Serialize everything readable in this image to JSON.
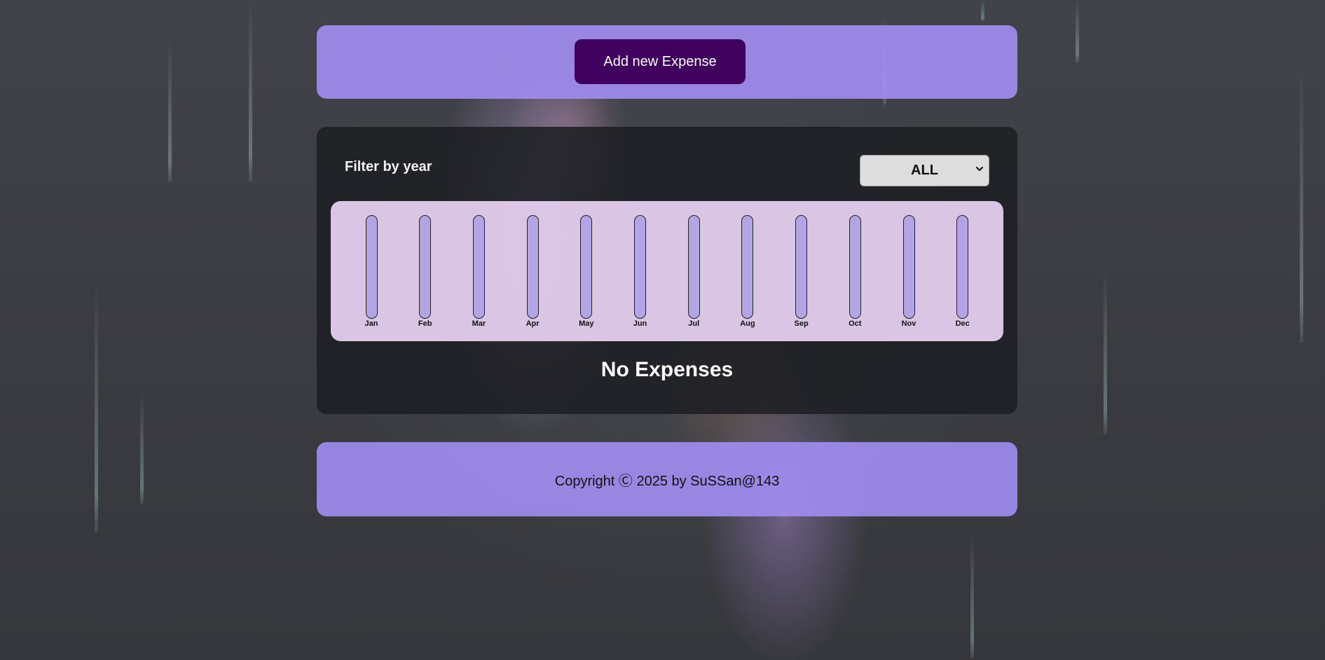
{
  "header": {
    "add_button_label": "Add new Expense"
  },
  "filter": {
    "label": "Filter by year",
    "selected_year": "ALL"
  },
  "chart_data": {
    "type": "bar",
    "categories": [
      "Jan",
      "Feb",
      "Mar",
      "Apr",
      "May",
      "Jun",
      "Jul",
      "Aug",
      "Sep",
      "Oct",
      "Nov",
      "Dec"
    ],
    "values": [
      0,
      0,
      0,
      0,
      0,
      0,
      0,
      0,
      0,
      0,
      0,
      0
    ],
    "title": "",
    "xlabel": "",
    "ylabel": "",
    "ylim": [
      0,
      1
    ]
  },
  "expenses": {
    "empty_message": "No Expenses"
  },
  "footer": {
    "copyright": "Copyright Ⓒ 2025 by SuSSan@143"
  },
  "icons": {
    "select_arrow": "chevron-down-icon"
  },
  "colors": {
    "accent": "#40005d",
    "panel": "#a08cf0",
    "bar_track": "#b3a4e6",
    "bar_fill": "#4826b9"
  }
}
